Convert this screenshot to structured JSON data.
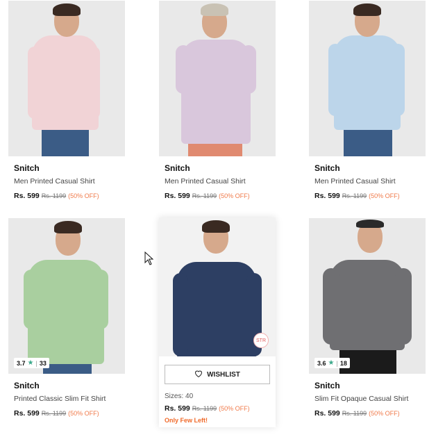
{
  "products": [
    {
      "brand": "Snitch",
      "title": "Men Printed Casual Shirt",
      "price": "Rs. 599",
      "mrp": "Rs. 1199",
      "discount": "(50% OFF)",
      "shirt_color": "#f1d3d6",
      "pants_color": "#3b5c86"
    },
    {
      "brand": "Snitch",
      "title": "Men Printed Casual Shirt",
      "price": "Rs. 599",
      "mrp": "Rs. 1199",
      "discount": "(50% OFF)",
      "shirt_color": "#d9c7dc",
      "pants_color": "#e08a70"
    },
    {
      "brand": "Snitch",
      "title": "Men Printed Casual Shirt",
      "price": "Rs. 599",
      "mrp": "Rs. 1199",
      "discount": "(50% OFF)",
      "shirt_color": "#bcd5ea",
      "pants_color": "#3b5c86"
    },
    {
      "brand": "Snitch",
      "title": "Printed Classic Slim Fit Shirt",
      "price": "Rs. 599",
      "mrp": "Rs. 1199",
      "discount": "(50% OFF)",
      "rating": "3.7",
      "rating_count": "33",
      "shirt_color": "#a9cf9f",
      "pants_color": "#3b5c86"
    },
    {
      "price": "Rs. 599",
      "mrp": "Rs. 1199",
      "discount": "(50% OFF)",
      "wishlist_label": "WISHLIST",
      "sizes": "Sizes: 40",
      "stock_note": "Only Few Left!",
      "shirt_color": "#2d3f63",
      "pants_color": "#2d3f63"
    },
    {
      "brand": "Snitch",
      "title": "Slim Fit Opaque Casual Shirt",
      "price": "Rs. 599",
      "mrp": "Rs. 1199",
      "discount": "(50% OFF)",
      "rating": "3.6",
      "rating_count": "18",
      "shirt_color": "#6f6f72",
      "pants_color": "#1b1b1b"
    }
  ]
}
